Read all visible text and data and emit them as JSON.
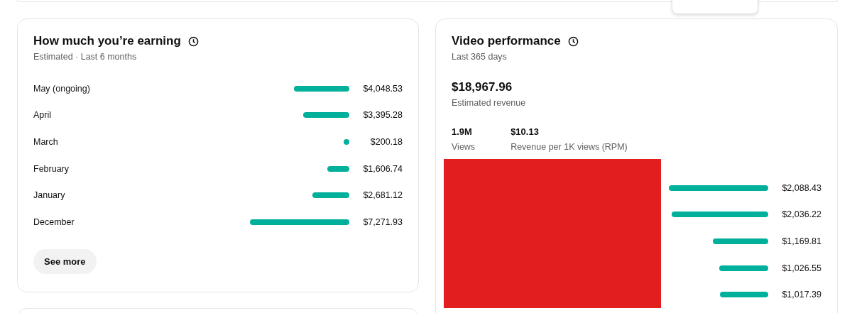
{
  "earnings": {
    "title": "How much you’re earning",
    "subtitle": "Estimated · Last 6 months",
    "rows": [
      {
        "label": "May (ongoing)",
        "amount": "$4,048.53"
      },
      {
        "label": "April",
        "amount": "$3,395.28"
      },
      {
        "label": "March",
        "amount": "$200.18"
      },
      {
        "label": "February",
        "amount": "$1,606.74"
      },
      {
        "label": "January",
        "amount": "$2,681.12"
      },
      {
        "label": "December",
        "amount": "$7,271.93"
      }
    ],
    "button": "See more"
  },
  "performance": {
    "title": "Video performance",
    "subtitle": "Last 365 days",
    "revenue": "$18,967.96",
    "revenue_label": "Estimated revenue",
    "stats": [
      {
        "value": "1.9M",
        "label": "Views"
      },
      {
        "value": "$10.13",
        "label": "Revenue per 1K views (RPM)"
      }
    ],
    "videos": [
      {
        "amount": "$2,088.43"
      },
      {
        "amount": "$2,036.22"
      },
      {
        "amount": "$1,169.81"
      },
      {
        "amount": "$1,026.55"
      },
      {
        "amount": "$1,017.39"
      }
    ]
  }
}
